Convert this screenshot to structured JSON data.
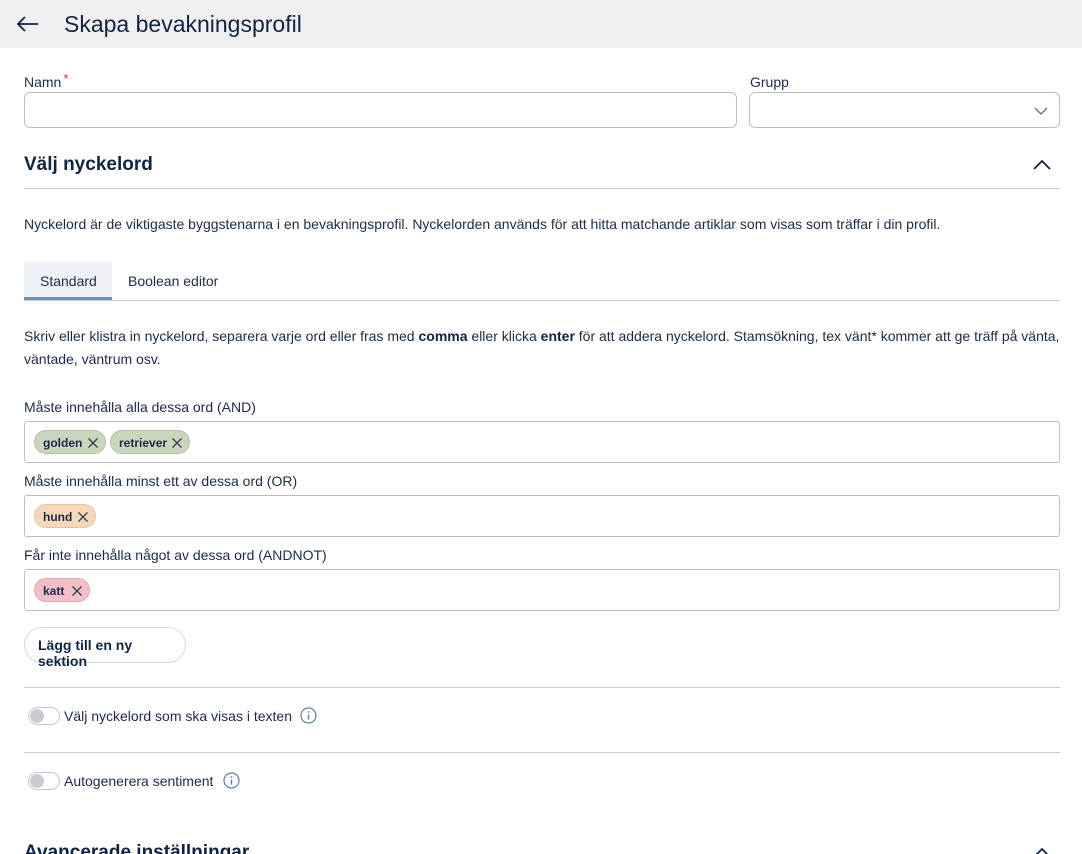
{
  "header": {
    "title": "Skapa bevakningsprofil",
    "back_icon": "arrow-left-icon"
  },
  "form": {
    "name_label": "Namn",
    "required_mark": "*",
    "name_value": "",
    "group_label": "Grupp",
    "group_value": ""
  },
  "keywords_section": {
    "title": "Välj nyckelord",
    "description": "Nyckelord är de viktigaste byggstenarna i en bevakningsprofil. Nyckelorden används för att hitta matchande artiklar som visas som träffar i din profil.",
    "tabs": [
      {
        "label": "Standard",
        "active": true
      },
      {
        "label": "Boolean editor",
        "active": false
      }
    ],
    "instructions": {
      "part1": "Skriv eller klistra in nyckelord, separera varje ord eller fras med ",
      "bold1": "comma",
      "part2": " eller klicka ",
      "bold2": "enter",
      "part3": " för att addera nyckelord. Stamsökning, tex vänt* kommer att ge träff på vänta, väntade, väntrum osv."
    },
    "and_label": "Måste innehålla alla dessa ord (AND)",
    "and_tags": [
      "golden",
      "retriever"
    ],
    "or_label": "Måste innehålla minst ett av dessa ord (OR)",
    "or_tags": [
      "hund"
    ],
    "not_label": "Får inte innehålla något av dessa ord (ANDNOT)",
    "not_tags": [
      "katt"
    ],
    "add_section_button": "Lägg till en ny sektion"
  },
  "options": {
    "highlight_label": "Välj nyckelord som ska visas i texten",
    "sentiment_label": "Autogenerera sentiment"
  },
  "next_section_title": "Avancerade inställningar"
}
